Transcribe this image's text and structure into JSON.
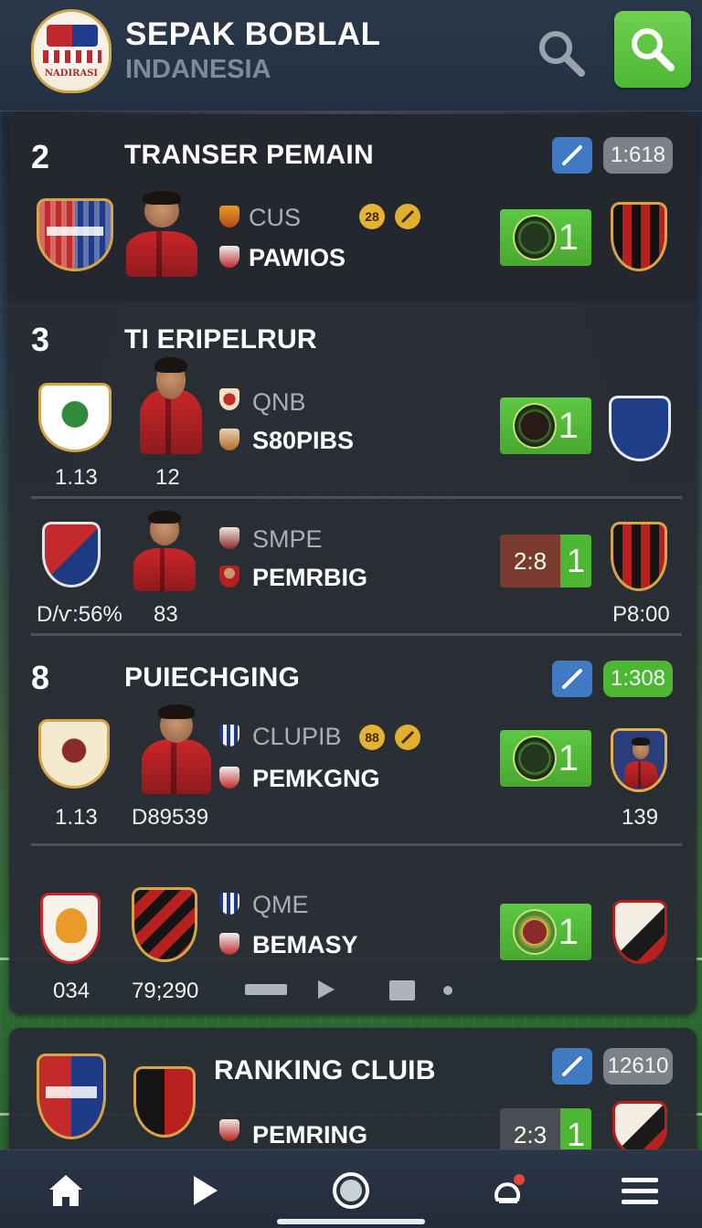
{
  "app": {
    "title": "SEPAK BOBLAL",
    "subtitle": "INDANESIA",
    "logo_text": "NADIRASI"
  },
  "sections": [
    {
      "number": "2",
      "title": "TRANSER PEMAIN",
      "time_badge": "1:618",
      "rows": [
        {
          "line1": "CUS",
          "line2": "PAWIOS",
          "coin": "28",
          "score": "1"
        }
      ]
    },
    {
      "number": "3",
      "title": "TI ERIPELRUR",
      "rows": [
        {
          "line1": "QNB",
          "line2": "S80PIBS",
          "score": "1",
          "stat_left": "1.13",
          "stat_mid": "12"
        },
        {
          "line1": "SMPE",
          "line2": "PEMRBIG",
          "score_left": "2:8",
          "score": "1",
          "stat_left": "D/ѵ:56%",
          "stat_mid": "83",
          "stat_right": "P8:00"
        }
      ]
    },
    {
      "number": "8",
      "title": "PUIECHGING",
      "time_badge": "1:308",
      "rows": [
        {
          "line1": "CLUPIB",
          "line2": "PEMKGNG",
          "coin": "88",
          "score": "1",
          "stat_left": "1.13",
          "stat_mid": "D89539",
          "stat_right": "139"
        },
        {
          "line1": "QME",
          "line2": "BEMASY",
          "score": "1",
          "stat_left": "034",
          "stat_mid": "79;290"
        }
      ]
    },
    {
      "title": "RANKING CLUIB",
      "time_badge": "12610",
      "rows": [
        {
          "line2": "PEMRING",
          "score_left": "2:3",
          "score": "1"
        }
      ]
    }
  ],
  "colors": {
    "accent_green": "#4db733",
    "tool_blue": "#3f7ac2",
    "card_bg": "#292d34",
    "score_red": "#7b3a2e"
  },
  "nav": {
    "items": [
      "home-icon",
      "play-icon",
      "record-icon",
      "notification-icon",
      "menu-icon"
    ]
  }
}
